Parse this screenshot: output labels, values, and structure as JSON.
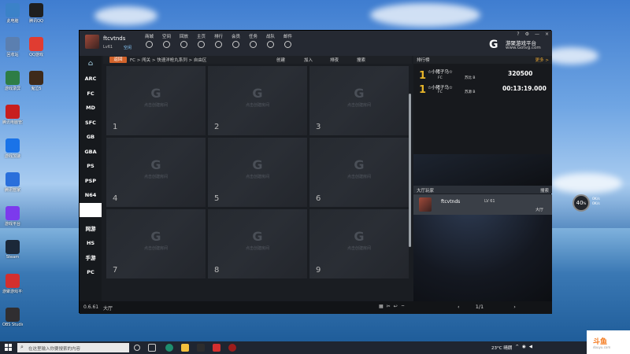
{
  "desktop": {
    "icons_col1": [
      {
        "label": "此电脑",
        "color": "#3b82c8"
      },
      {
        "label": "回收站",
        "color": "#5b7fb0"
      },
      {
        "label": "游戏录屏",
        "color": "#2e7d46"
      },
      {
        "label": "腾讯电脑管家",
        "color": "#c81e1e"
      },
      {
        "label": "游戏加速",
        "color": "#1a73e8"
      },
      {
        "label": "腾讯管家",
        "color": "#2a6fdb"
      },
      {
        "label": "游戏平台",
        "color": "#7c3aed"
      },
      {
        "label": "Steam",
        "color": "#1b2838"
      },
      {
        "label": "游聚游戏平台",
        "color": "#d32f2f"
      },
      {
        "label": "OBS Studio",
        "color": "#302e31"
      }
    ],
    "icons_col2": [
      {
        "label": "腾讯QQ",
        "color": "#1f1f1f"
      },
      {
        "label": "QQ游戏",
        "color": "#e03c31"
      },
      {
        "label": "鬼泣5",
        "color": "#3e2a1a"
      }
    ]
  },
  "app": {
    "user": {
      "name": "ftcvtnds",
      "level": "Lv61",
      "status": "空闲"
    },
    "topnav": [
      {
        "label": "商城",
        "icon": "shop-icon"
      },
      {
        "label": "空间",
        "icon": "space-icon"
      },
      {
        "label": "回放",
        "icon": "replay-icon"
      },
      {
        "label": "主页",
        "icon": "home-icon"
      },
      {
        "label": "排行",
        "icon": "rank-icon"
      },
      {
        "label": "会员",
        "icon": "vip-icon"
      },
      {
        "label": "任务",
        "icon": "task-icon"
      },
      {
        "label": "战队",
        "icon": "team-icon"
      },
      {
        "label": "邮件",
        "icon": "mail-icon"
      }
    ],
    "brand": {
      "name": "游聚游戏平台",
      "url": "www.Gotvg.com"
    },
    "window_controls": [
      "?",
      "⚙",
      "—",
      "×"
    ],
    "leftnav": {
      "platforms": [
        "ARC",
        "FC",
        "MD",
        "SFC",
        "GB",
        "GBA",
        "PS",
        "PSP",
        "N64",
        ""
      ],
      "others": [
        "网游",
        "HS",
        "手游",
        "PC"
      ]
    },
    "crumb": {
      "badge": "返回",
      "path": "FC > 闯关 > 快速洋枪丸系列 > 自由区",
      "actions": [
        "创建",
        "加入",
        "排夜",
        "搜索"
      ]
    },
    "rooms": [
      {
        "num": "1",
        "hint": "点击创建房间"
      },
      {
        "num": "2",
        "hint": "点击创建房间"
      },
      {
        "num": "3",
        "hint": "点击创建房间"
      },
      {
        "num": "4",
        "hint": "点击创建房间"
      },
      {
        "num": "5",
        "hint": "点击创建房间"
      },
      {
        "num": "6",
        "hint": "点击创建房间"
      },
      {
        "num": "7",
        "hint": "点击创建房间"
      },
      {
        "num": "8",
        "hint": "点击创建房间"
      },
      {
        "num": "9",
        "hint": "点击创建房间"
      }
    ],
    "statusbar": {
      "version": "0.6.61",
      "hall": "大厅",
      "page": "1/1",
      "prev": "‹",
      "next": "›"
    },
    "ranking": {
      "title": "排行榜",
      "more": "更多 >",
      "entries": [
        {
          "rank": "1",
          "name": "☆小猪子乌☆",
          "tag": "FC",
          "sub": "苏比 B",
          "score": "320500"
        },
        {
          "rank": "1",
          "name": "☆小猪子乌☆",
          "tag": "FC",
          "sub": "苏源 B",
          "score": "00:13:19.000"
        }
      ]
    },
    "hall_panel": {
      "title": "大厅玩家",
      "search": "搜索",
      "member": {
        "name": "ftcvtnds",
        "level": "LV 61",
        "location": "大厅"
      }
    }
  },
  "widget": {
    "value": "40",
    "unit": "%",
    "line1": "0K/s",
    "line2": "0K/s"
  },
  "taskbar": {
    "search_placeholder": "在这里输入你要搜索的内容",
    "weather": "23°C 晴朗",
    "clock_brand": "斗鱼",
    "clock_sub": "douyu.com"
  },
  "colors": {
    "accent": "#d2632b",
    "rank_gold": "#e7b52a"
  }
}
